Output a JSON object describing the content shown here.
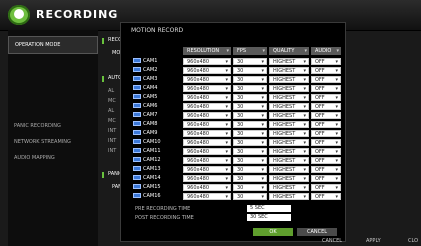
{
  "app": {
    "title": "RECORDING"
  },
  "left_menu": [
    {
      "label": "OPERATION MODE",
      "active": true
    },
    {
      "label": "",
      "active": false
    },
    {
      "label": "",
      "active": false
    },
    {
      "label": "",
      "active": false
    },
    {
      "label": "",
      "active": false
    },
    {
      "label": "PANIC RECORDING",
      "active": false
    },
    {
      "label": "NETWORK STREAMING",
      "active": false
    },
    {
      "label": "AUDIO MAPPING",
      "active": false
    }
  ],
  "behind": {
    "record_label": "RECOR",
    "mode_label": "MODE",
    "auto_label": "AUTON",
    "opts": [
      "AL",
      "MC",
      "AL",
      "MC",
      "INT",
      "INT",
      "INT"
    ],
    "panic_label": "PANIC",
    "panic2_label": "PANIC"
  },
  "dialog": {
    "title": "MOTION RECORD",
    "headers": {
      "resolution": "RESOLUTION",
      "fps": "FPS",
      "quality": "QUALITY",
      "audio": "AUDIO"
    },
    "cameras": [
      {
        "name": "CAM1",
        "resolution": "960x480",
        "fps": "30",
        "quality": "HIGHEST",
        "audio": "OFF"
      },
      {
        "name": "CAM2",
        "resolution": "960x480",
        "fps": "30",
        "quality": "HIGHEST",
        "audio": "OFF"
      },
      {
        "name": "CAM3",
        "resolution": "960x480",
        "fps": "30",
        "quality": "HIGHEST",
        "audio": "OFF"
      },
      {
        "name": "CAM4",
        "resolution": "960x480",
        "fps": "30",
        "quality": "HIGHEST",
        "audio": "OFF"
      },
      {
        "name": "CAM5",
        "resolution": "960x480",
        "fps": "30",
        "quality": "HIGHEST",
        "audio": "OFF"
      },
      {
        "name": "CAM6",
        "resolution": "960x480",
        "fps": "30",
        "quality": "HIGHEST",
        "audio": "OFF"
      },
      {
        "name": "CAM7",
        "resolution": "960x480",
        "fps": "30",
        "quality": "HIGHEST",
        "audio": "OFF"
      },
      {
        "name": "CAM8",
        "resolution": "960x480",
        "fps": "30",
        "quality": "HIGHEST",
        "audio": "OFF"
      },
      {
        "name": "CAM9",
        "resolution": "960x480",
        "fps": "30",
        "quality": "HIGHEST",
        "audio": "OFF"
      },
      {
        "name": "CAM10",
        "resolution": "960x480",
        "fps": "30",
        "quality": "HIGHEST",
        "audio": "OFF"
      },
      {
        "name": "CAM11",
        "resolution": "960x480",
        "fps": "30",
        "quality": "HIGHEST",
        "audio": "OFF"
      },
      {
        "name": "CAM12",
        "resolution": "960x480",
        "fps": "30",
        "quality": "HIGHEST",
        "audio": "OFF"
      },
      {
        "name": "CAM13",
        "resolution": "960x480",
        "fps": "30",
        "quality": "HIGHEST",
        "audio": "OFF"
      },
      {
        "name": "CAM14",
        "resolution": "960x480",
        "fps": "30",
        "quality": "HIGHEST",
        "audio": "OFF"
      },
      {
        "name": "CAM15",
        "resolution": "960x480",
        "fps": "30",
        "quality": "HIGHEST",
        "audio": "OFF"
      },
      {
        "name": "CAM16",
        "resolution": "960x480",
        "fps": "30",
        "quality": "HIGHEST",
        "audio": "OFF"
      }
    ],
    "pre_recording_label": "PRE RECORDING TIME",
    "pre_recording_value": "5 SEC",
    "post_recording_label": "POST RECORDING TIME",
    "post_recording_value": "30 SEC",
    "ok_label": "OK",
    "cancel_label": "CANCEL"
  },
  "bottom_bar": {
    "cancel_label": "CANCEL",
    "apply_label": "APPLY",
    "close_label": "CLO"
  },
  "colors": {
    "accent_green": "#5f9e2d",
    "header_gray": "#5a5a5a",
    "camera_icon_blue": "#3b78d8"
  }
}
